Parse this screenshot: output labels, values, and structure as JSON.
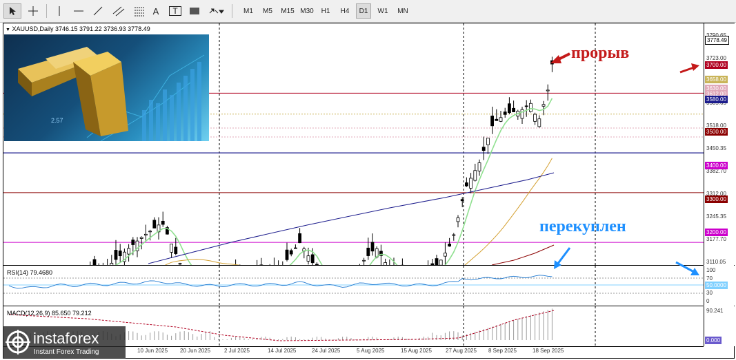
{
  "toolbar": {
    "timeframes": [
      "M1",
      "M5",
      "M15",
      "M30",
      "H1",
      "H4",
      "D1",
      "W1",
      "MN"
    ],
    "active_timeframe": "D1",
    "text_tool_label": "A",
    "text_label_tool_label": "T"
  },
  "chart": {
    "symbol_info": "XAUUSD,Daily",
    "open": "3746.15",
    "high": "3791.22",
    "low": "3736.93",
    "close": "3778.49"
  },
  "price_axis": {
    "labels": [
      "3790.65",
      "3723.00",
      "3585.65",
      "3518.00",
      "3450.35",
      "3382.70",
      "3312.00",
      "3245.35",
      "3177.70",
      "3110.05"
    ],
    "current_price": "3778.49",
    "current_price_color": "#000000",
    "level_tags": [
      {
        "text": "3700.00",
        "color": "#b00020"
      },
      {
        "text": "3658.00",
        "color": "#c9b458"
      },
      {
        "text": "3630.00",
        "color": "#e0a8b8"
      },
      {
        "text": "3612.00",
        "color": "#e0a8b8"
      },
      {
        "text": "3580.00",
        "color": "#1b1b8c"
      },
      {
        "text": "3500.00",
        "color": "#8b0000"
      },
      {
        "text": "3400.00",
        "color": "#cc00cc"
      },
      {
        "text": "3300.00",
        "color": "#8b0000"
      },
      {
        "text": "3200.00",
        "color": "#cc00cc"
      }
    ]
  },
  "rsi": {
    "label": "RSI(14) 79.4680",
    "axis_labels": [
      "100",
      "70",
      "30",
      "0"
    ],
    "tag": "50.0000",
    "tag_color": "#80d0ff"
  },
  "macd": {
    "label": "MACD(12,26,9) 85.650 79.212",
    "axis_top": "90.241",
    "tag": "0.000",
    "tag_color": "#6a5acd"
  },
  "time_axis": [
    "10 Jun 2025",
    "20 Jun 2025",
    "2 Jul 2025",
    "14 Jul 2025",
    "24 Jul 2025",
    "5 Aug 2025",
    "15 Aug 2025",
    "27 Aug 2025",
    "8 Sep 2025",
    "18 Sep 2025"
  ],
  "annotations": {
    "breakout": "прорыв",
    "breakout_color": "#c41a1a",
    "overbought": "перекуплен",
    "overbought_color": "#1e90ff"
  },
  "image_text": {
    "price_sticker": "2.57"
  },
  "logo": {
    "brand": "instaforex",
    "tagline": "Instant Forex Trading"
  }
}
